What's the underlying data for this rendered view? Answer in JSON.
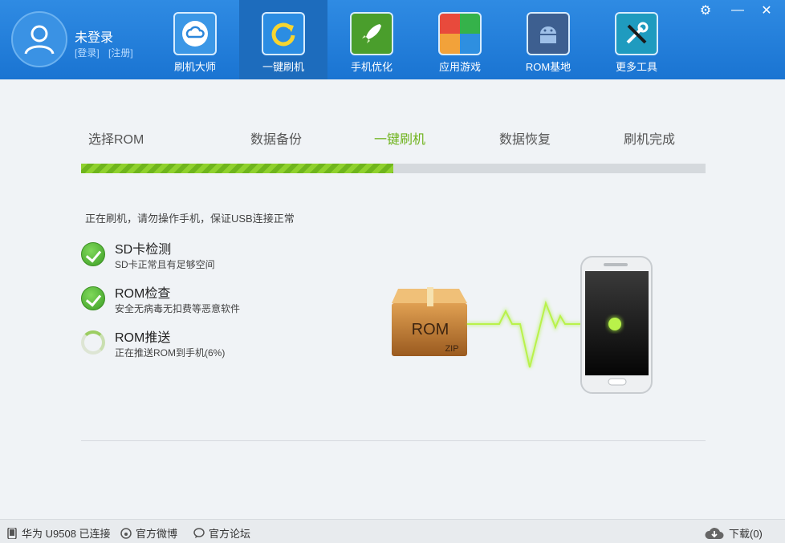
{
  "user": {
    "name": "未登录",
    "login": "[登录]",
    "register": "[注册]"
  },
  "nav": [
    {
      "label": "刷机大师",
      "icon": "cloud-icon",
      "active": false
    },
    {
      "label": "一键刷机",
      "icon": "refresh-icon",
      "active": true
    },
    {
      "label": "手机优化",
      "icon": "rocket-icon",
      "active": false
    },
    {
      "label": "应用游戏",
      "icon": "tiles-icon",
      "active": false
    },
    {
      "label": "ROM基地",
      "icon": "android-icon",
      "active": false
    },
    {
      "label": "更多工具",
      "icon": "tools-icon",
      "active": false
    }
  ],
  "steps": [
    "选择ROM",
    "数据备份",
    "一键刷机",
    "数据恢复",
    "刷机完成"
  ],
  "current_step": 2,
  "progress_fraction": 0.5,
  "status_text": "正在刷机，请勿操作手机，保证USB连接正常",
  "checks": [
    {
      "title": "SD卡检测",
      "desc": "SD卡正常且有足够空间",
      "state": "done"
    },
    {
      "title": "ROM检查",
      "desc": "安全无病毒无扣费等恶意软件",
      "state": "done"
    },
    {
      "title": "ROM推送",
      "desc": "正在推送ROM到手机(6%)",
      "state": "pending"
    }
  ],
  "illustration": {
    "box_label": "ROM",
    "box_sub": "ZIP"
  },
  "footer": {
    "device": "华为 U9508 已连接",
    "weibo": "官方微博",
    "forum": "官方论坛",
    "download": "下载(0)"
  },
  "colors": {
    "header": "#2080dc",
    "accent_green": "#6fb31d",
    "progress_track": "#d5d9dd"
  }
}
